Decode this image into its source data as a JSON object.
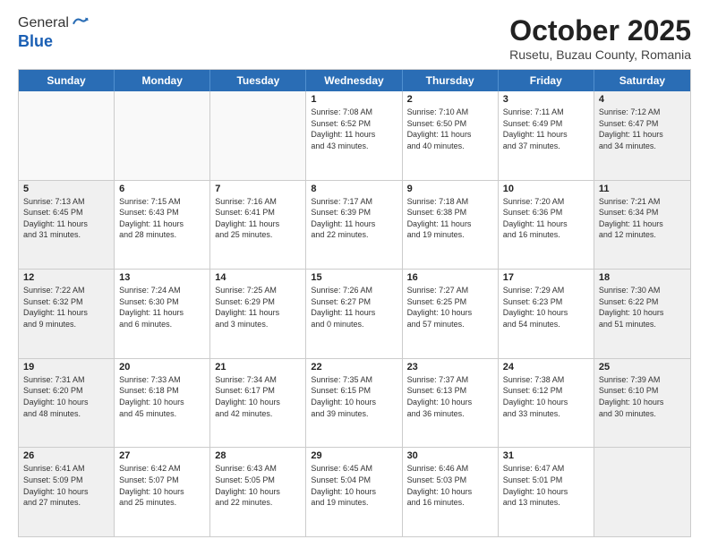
{
  "header": {
    "logo_line1": "General",
    "logo_line2": "Blue",
    "month": "October 2025",
    "location": "Rusetu, Buzau County, Romania"
  },
  "weekdays": [
    "Sunday",
    "Monday",
    "Tuesday",
    "Wednesday",
    "Thursday",
    "Friday",
    "Saturday"
  ],
  "rows": [
    [
      {
        "day": "",
        "info": "",
        "shaded": false,
        "empty": true
      },
      {
        "day": "",
        "info": "",
        "shaded": false,
        "empty": true
      },
      {
        "day": "",
        "info": "",
        "shaded": false,
        "empty": true
      },
      {
        "day": "1",
        "info": "Sunrise: 7:08 AM\nSunset: 6:52 PM\nDaylight: 11 hours\nand 43 minutes.",
        "shaded": false,
        "empty": false
      },
      {
        "day": "2",
        "info": "Sunrise: 7:10 AM\nSunset: 6:50 PM\nDaylight: 11 hours\nand 40 minutes.",
        "shaded": false,
        "empty": false
      },
      {
        "day": "3",
        "info": "Sunrise: 7:11 AM\nSunset: 6:49 PM\nDaylight: 11 hours\nand 37 minutes.",
        "shaded": false,
        "empty": false
      },
      {
        "day": "4",
        "info": "Sunrise: 7:12 AM\nSunset: 6:47 PM\nDaylight: 11 hours\nand 34 minutes.",
        "shaded": true,
        "empty": false
      }
    ],
    [
      {
        "day": "5",
        "info": "Sunrise: 7:13 AM\nSunset: 6:45 PM\nDaylight: 11 hours\nand 31 minutes.",
        "shaded": true,
        "empty": false
      },
      {
        "day": "6",
        "info": "Sunrise: 7:15 AM\nSunset: 6:43 PM\nDaylight: 11 hours\nand 28 minutes.",
        "shaded": false,
        "empty": false
      },
      {
        "day": "7",
        "info": "Sunrise: 7:16 AM\nSunset: 6:41 PM\nDaylight: 11 hours\nand 25 minutes.",
        "shaded": false,
        "empty": false
      },
      {
        "day": "8",
        "info": "Sunrise: 7:17 AM\nSunset: 6:39 PM\nDaylight: 11 hours\nand 22 minutes.",
        "shaded": false,
        "empty": false
      },
      {
        "day": "9",
        "info": "Sunrise: 7:18 AM\nSunset: 6:38 PM\nDaylight: 11 hours\nand 19 minutes.",
        "shaded": false,
        "empty": false
      },
      {
        "day": "10",
        "info": "Sunrise: 7:20 AM\nSunset: 6:36 PM\nDaylight: 11 hours\nand 16 minutes.",
        "shaded": false,
        "empty": false
      },
      {
        "day": "11",
        "info": "Sunrise: 7:21 AM\nSunset: 6:34 PM\nDaylight: 11 hours\nand 12 minutes.",
        "shaded": true,
        "empty": false
      }
    ],
    [
      {
        "day": "12",
        "info": "Sunrise: 7:22 AM\nSunset: 6:32 PM\nDaylight: 11 hours\nand 9 minutes.",
        "shaded": true,
        "empty": false
      },
      {
        "day": "13",
        "info": "Sunrise: 7:24 AM\nSunset: 6:30 PM\nDaylight: 11 hours\nand 6 minutes.",
        "shaded": false,
        "empty": false
      },
      {
        "day": "14",
        "info": "Sunrise: 7:25 AM\nSunset: 6:29 PM\nDaylight: 11 hours\nand 3 minutes.",
        "shaded": false,
        "empty": false
      },
      {
        "day": "15",
        "info": "Sunrise: 7:26 AM\nSunset: 6:27 PM\nDaylight: 11 hours\nand 0 minutes.",
        "shaded": false,
        "empty": false
      },
      {
        "day": "16",
        "info": "Sunrise: 7:27 AM\nSunset: 6:25 PM\nDaylight: 10 hours\nand 57 minutes.",
        "shaded": false,
        "empty": false
      },
      {
        "day": "17",
        "info": "Sunrise: 7:29 AM\nSunset: 6:23 PM\nDaylight: 10 hours\nand 54 minutes.",
        "shaded": false,
        "empty": false
      },
      {
        "day": "18",
        "info": "Sunrise: 7:30 AM\nSunset: 6:22 PM\nDaylight: 10 hours\nand 51 minutes.",
        "shaded": true,
        "empty": false
      }
    ],
    [
      {
        "day": "19",
        "info": "Sunrise: 7:31 AM\nSunset: 6:20 PM\nDaylight: 10 hours\nand 48 minutes.",
        "shaded": true,
        "empty": false
      },
      {
        "day": "20",
        "info": "Sunrise: 7:33 AM\nSunset: 6:18 PM\nDaylight: 10 hours\nand 45 minutes.",
        "shaded": false,
        "empty": false
      },
      {
        "day": "21",
        "info": "Sunrise: 7:34 AM\nSunset: 6:17 PM\nDaylight: 10 hours\nand 42 minutes.",
        "shaded": false,
        "empty": false
      },
      {
        "day": "22",
        "info": "Sunrise: 7:35 AM\nSunset: 6:15 PM\nDaylight: 10 hours\nand 39 minutes.",
        "shaded": false,
        "empty": false
      },
      {
        "day": "23",
        "info": "Sunrise: 7:37 AM\nSunset: 6:13 PM\nDaylight: 10 hours\nand 36 minutes.",
        "shaded": false,
        "empty": false
      },
      {
        "day": "24",
        "info": "Sunrise: 7:38 AM\nSunset: 6:12 PM\nDaylight: 10 hours\nand 33 minutes.",
        "shaded": false,
        "empty": false
      },
      {
        "day": "25",
        "info": "Sunrise: 7:39 AM\nSunset: 6:10 PM\nDaylight: 10 hours\nand 30 minutes.",
        "shaded": true,
        "empty": false
      }
    ],
    [
      {
        "day": "26",
        "info": "Sunrise: 6:41 AM\nSunset: 5:09 PM\nDaylight: 10 hours\nand 27 minutes.",
        "shaded": true,
        "empty": false
      },
      {
        "day": "27",
        "info": "Sunrise: 6:42 AM\nSunset: 5:07 PM\nDaylight: 10 hours\nand 25 minutes.",
        "shaded": false,
        "empty": false
      },
      {
        "day": "28",
        "info": "Sunrise: 6:43 AM\nSunset: 5:05 PM\nDaylight: 10 hours\nand 22 minutes.",
        "shaded": false,
        "empty": false
      },
      {
        "day": "29",
        "info": "Sunrise: 6:45 AM\nSunset: 5:04 PM\nDaylight: 10 hours\nand 19 minutes.",
        "shaded": false,
        "empty": false
      },
      {
        "day": "30",
        "info": "Sunrise: 6:46 AM\nSunset: 5:03 PM\nDaylight: 10 hours\nand 16 minutes.",
        "shaded": false,
        "empty": false
      },
      {
        "day": "31",
        "info": "Sunrise: 6:47 AM\nSunset: 5:01 PM\nDaylight: 10 hours\nand 13 minutes.",
        "shaded": false,
        "empty": false
      },
      {
        "day": "",
        "info": "",
        "shaded": true,
        "empty": true
      }
    ]
  ]
}
